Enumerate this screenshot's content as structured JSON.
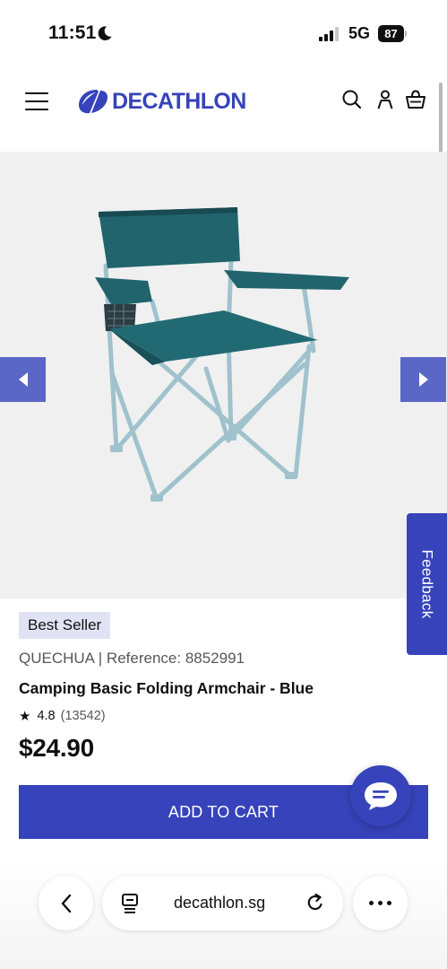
{
  "status_bar": {
    "time": "11:51",
    "network": "5G",
    "battery": "87"
  },
  "header": {
    "brand": "DECATHLON",
    "brand_color": "#3643ba",
    "icons": [
      "menu-icon",
      "search-icon",
      "account-icon",
      "cart-icon"
    ]
  },
  "gallery": {
    "image_subject": "folding-armchair-image",
    "prev_icon": "arrow-left-icon",
    "next_icon": "arrow-right-icon",
    "arrow_color": "#5a67c6"
  },
  "feedback": {
    "label": "Feedback"
  },
  "product": {
    "badge": "Best Seller",
    "brand_reference": "QUECHUA | Reference: 8852991",
    "title": "Camping Basic Folding Armchair - Blue",
    "rating": "4.8",
    "review_count": "(13542)",
    "price": "$24.90"
  },
  "actions": {
    "add_to_cart_label": "ADD TO CART",
    "chat_icon": "chat-bubble-icon"
  },
  "browser": {
    "url": "decathlon.sg",
    "icons": [
      "back-icon",
      "reader-icon",
      "reload-icon",
      "more-icon"
    ]
  }
}
